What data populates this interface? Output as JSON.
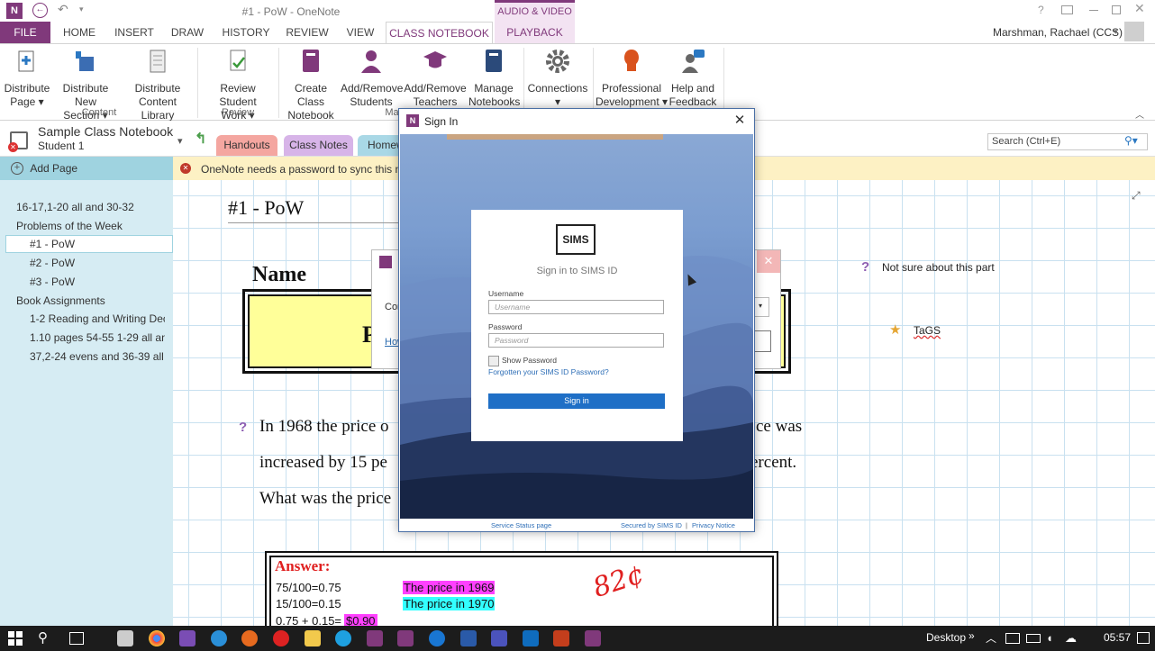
{
  "window": {
    "title": "#1 - PoW - OneNote",
    "contextual_tab_group": "AUDIO & VIDEO",
    "user": "Marshman, Rachael (CCS)"
  },
  "ribbon": {
    "tabs": [
      "FILE",
      "HOME",
      "INSERT",
      "DRAW",
      "HISTORY",
      "REVIEW",
      "VIEW",
      "CLASS NOTEBOOK",
      "PLAYBACK"
    ],
    "buttons": [
      {
        "l1": "Distribute",
        "l2": "Page ▾"
      },
      {
        "l1": "Distribute New",
        "l2": "Section ▾"
      },
      {
        "l1": "Distribute",
        "l2": "Content Library"
      },
      {
        "l1": "Review Student",
        "l2": "Work ▾"
      },
      {
        "l1": "Create Class",
        "l2": "Notebook"
      },
      {
        "l1": "Add/Remove",
        "l2": "Students"
      },
      {
        "l1": "Add/Remove",
        "l2": "Teachers"
      },
      {
        "l1": "Manage",
        "l2": "Notebooks"
      },
      {
        "l1": "Connections",
        "l2": "▾"
      },
      {
        "l1": "Professional",
        "l2": "Development ▾"
      },
      {
        "l1": "Help and",
        "l2": "Feedback ▾"
      }
    ],
    "groups": [
      "Content",
      "Review",
      "Ma"
    ]
  },
  "notebook": {
    "name": "Sample Class Notebook",
    "student": "Student 1",
    "sections": [
      "Handouts",
      "Class Notes",
      "Homew"
    ],
    "search_placeholder": "Search (Ctrl+E)"
  },
  "left_panel": {
    "add_page": "Add Page",
    "pages": [
      "16-17,1-20 all and 30-32",
      "Problems of the Week",
      "#1 - PoW",
      "#2 - PoW",
      "#3 - PoW",
      "Book Assignments",
      "1-2 Reading and Writing Deci",
      "1.10 pages 54-55 1-29 all and",
      "37,2-24 evens and 36-39 all"
    ]
  },
  "warning": "OneNote needs a password to sync this notel",
  "page": {
    "title": "#1 - PoW",
    "name_label": "Name",
    "box_letter": "P",
    "behind_dialog": {
      "line1": "Cor",
      "line2": "How"
    },
    "tags": {
      "not_sure": "Not sure about this part",
      "tags": "TaGS"
    },
    "question_lines": [
      {
        "left": "In 1968 the price o",
        "right": "ce was"
      },
      {
        "left": "increased by 15 pe",
        "right": "ercent."
      },
      {
        "left": "What was the price",
        "right": ""
      }
    ],
    "answer": {
      "label": "Answer:",
      "rows": [
        {
          "left": "75/100=0.75",
          "right": "The price in 1969"
        },
        {
          "left": "15/100=0.15",
          "right": "The price in 1970"
        },
        {
          "left": "0.75 + 0.15=",
          "hl": "$0.90"
        }
      ],
      "handwriting": "82¢"
    }
  },
  "dialog": {
    "title": "Sign In",
    "logo": "SIMS",
    "heading": "Sign in to SIMS ID",
    "username_label": "Username",
    "username_placeholder": "Username",
    "password_label": "Password",
    "password_placeholder": "Password",
    "show_password": "Show Password",
    "forgot": "Forgotten your SIMS ID Password?",
    "signin": "Sign in",
    "footer": {
      "status": "Service Status page",
      "secured": "Secured by SIMS ID",
      "sep": "|",
      "privacy": "Privacy Notice"
    }
  },
  "taskbar": {
    "desktop": "Desktop",
    "chevron": "»",
    "time": "05:57"
  }
}
